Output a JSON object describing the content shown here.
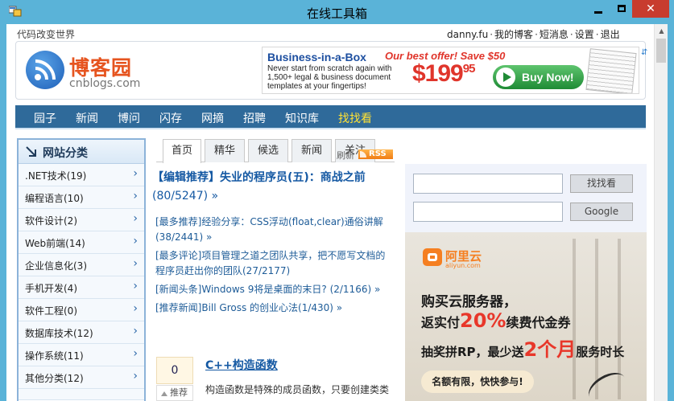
{
  "window": {
    "title": "在线工具箱"
  },
  "site": {
    "tagline": "代码改变世界",
    "user_links": [
      "danny.fu",
      "我的博客",
      "短消息",
      "设置",
      "退出"
    ],
    "logo_cn": "博客园",
    "logo_en": "cnblogs.com"
  },
  "ad": {
    "brand": "Business-in-a-Box",
    "offer": "Our best offer! Save $50",
    "desc": "Never start from scratch again with 1,500+ legal & business document templates at your fingertips!",
    "price": "$199",
    "price_cents": "95",
    "button": "Buy Now!"
  },
  "nav": {
    "items": [
      "园子",
      "新闻",
      "博问",
      "闪存",
      "网摘",
      "招聘",
      "知识库",
      "找找看"
    ]
  },
  "sidebar": {
    "title": "网站分类",
    "items": [
      ".NET技术(19)",
      "编程语言(10)",
      "软件设计(2)",
      "Web前端(14)",
      "企业信息化(3)",
      "手机开发(4)",
      "软件工程(0)",
      "数据库技术(12)",
      "操作系统(11)",
      "其他分类(12)"
    ]
  },
  "tabs": {
    "items": [
      "首页",
      "精华",
      "候选",
      "新闻",
      "关注"
    ],
    "active": "首页",
    "refresh": "刷新",
    "rss": "RSS"
  },
  "main": {
    "headline_tag": "【编辑推荐】",
    "headline_text": "失业的程序员(五)：商战之前",
    "headline_count": "(80/5247) »",
    "news": [
      "[最多推荐]经验分享：CSS浮动(float,clear)通俗讲解(38/2441) »",
      "[最多评论]项目管理之道之团队共享，把不愿写文档的程序员赶出你的团队(27/2177)",
      "[新闻头条]Windows 9将是桌面的末日? (2/1166) »",
      "[推荐新闻]Bill Gross 的创业心法(1/430) »"
    ],
    "post_votes": "0",
    "post_vote_label": "推荐",
    "post_title": "C++构造函数",
    "post_desc": "构造函数是特殊的成员函数，只要创建类类"
  },
  "search": {
    "button1": "找找看",
    "button2": "Google",
    "value1": "",
    "value2": ""
  },
  "aliad": {
    "name": "阿里云",
    "domain": "aliyun.com",
    "line1": "购买云服务器，",
    "line2_pre": "返实付",
    "line2_big": "20%",
    "line2_post": "续费代金券",
    "line3_pre": "抽奖拼RP，最少送",
    "line3_big": "2个月",
    "line3_post": "服务时长",
    "pill": "名额有限，快快参与!"
  },
  "colors": {
    "nav_bg": "#2f6a9a",
    "accent_orange": "#e6541f",
    "link_blue": "#1559a3",
    "highlight_yellow": "#ffe234"
  }
}
